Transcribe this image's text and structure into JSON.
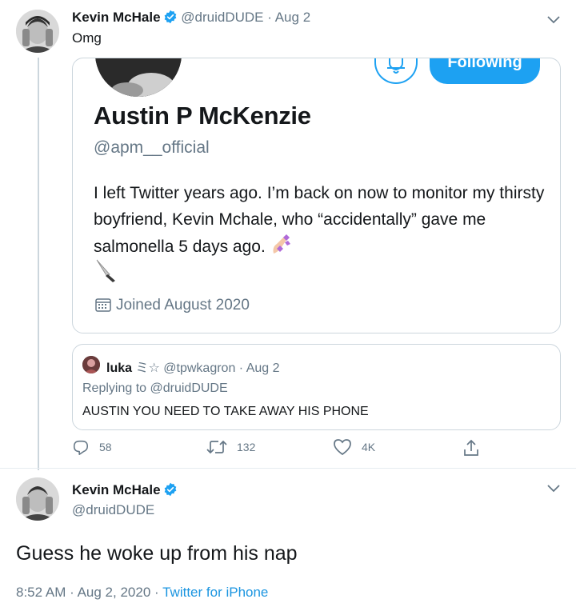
{
  "tweet_main": {
    "author_name": "Kevin McHale",
    "handle": "@druidDUDE",
    "separator": "·",
    "date": "Aug 2",
    "text": "Omg"
  },
  "embedded_profile": {
    "button_label": "Following",
    "name": "Austin P McKenzie",
    "handle": "@apm__official",
    "bio": "I left Twitter years ago. I’m back on now to monitor my thirsty boyfriend, Kevin Mchale, who “accidentally” gave me salmonella 5 days ago.",
    "joined": "Joined August 2020"
  },
  "embedded_reply": {
    "name": "luka",
    "name_suffix": "ミ☆",
    "handle": "@tpwkagron",
    "separator": "·",
    "date": "Aug 2",
    "replying_prefix": "Replying to",
    "replying_mention": "@druidDUDE",
    "text": "AUSTIN YOU NEED TO TAKE AWAY HIS PHONE"
  },
  "actions": {
    "replies": "58",
    "retweets": "132",
    "likes": "4K"
  },
  "tweet_reply": {
    "author_name": "Kevin McHale",
    "handle": "@druidDUDE",
    "text": "Guess he woke up from his nap",
    "time": "8:52 AM",
    "separator": "·",
    "date": "Aug 2, 2020",
    "separator2": "·",
    "source": "Twitter for iPhone"
  },
  "colors": {
    "accent": "#1da1f2",
    "muted": "#657786",
    "border": "#ccd6dd"
  }
}
